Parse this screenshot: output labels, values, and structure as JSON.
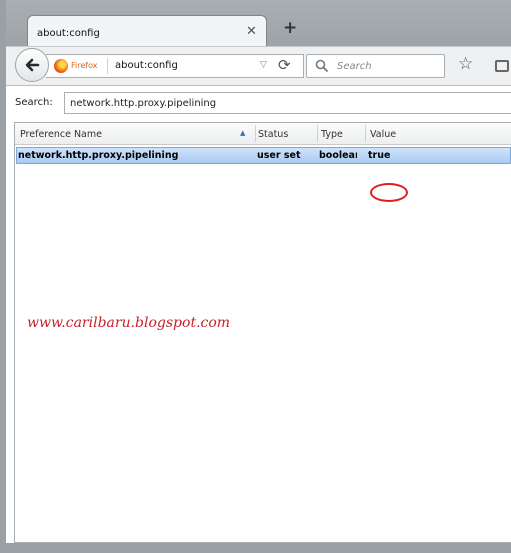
{
  "tab": {
    "title": "about:config",
    "close_glyph": "✕",
    "new_tab_glyph": "+"
  },
  "navbar": {
    "identity_label": "Firefox",
    "url": "about:config",
    "search_placeholder": "Search"
  },
  "config": {
    "search_label": "Search:",
    "search_value": "network.http.proxy.pipelining",
    "columns": {
      "name": "Preference Name",
      "status": "Status",
      "type": "Type",
      "value": "Value"
    },
    "rows": [
      {
        "name": "network.http.proxy.pipelining",
        "status": "user set",
        "type": "boolean",
        "value": "true"
      }
    ]
  },
  "watermark": "www.carilbaru.blogspot.com",
  "icons": [
    "back-arrow-icon",
    "firefox-logo-icon",
    "dropmarker-icon",
    "reload-icon",
    "search-icon",
    "star-icon",
    "clipboard-icon",
    "close-icon",
    "new-tab-icon",
    "sort-ascending-icon"
  ],
  "colors": {
    "selection": "#a9cbf2",
    "annotation": "#e11d1d",
    "watermark": "#c8202a",
    "identity": "#d2691e"
  }
}
